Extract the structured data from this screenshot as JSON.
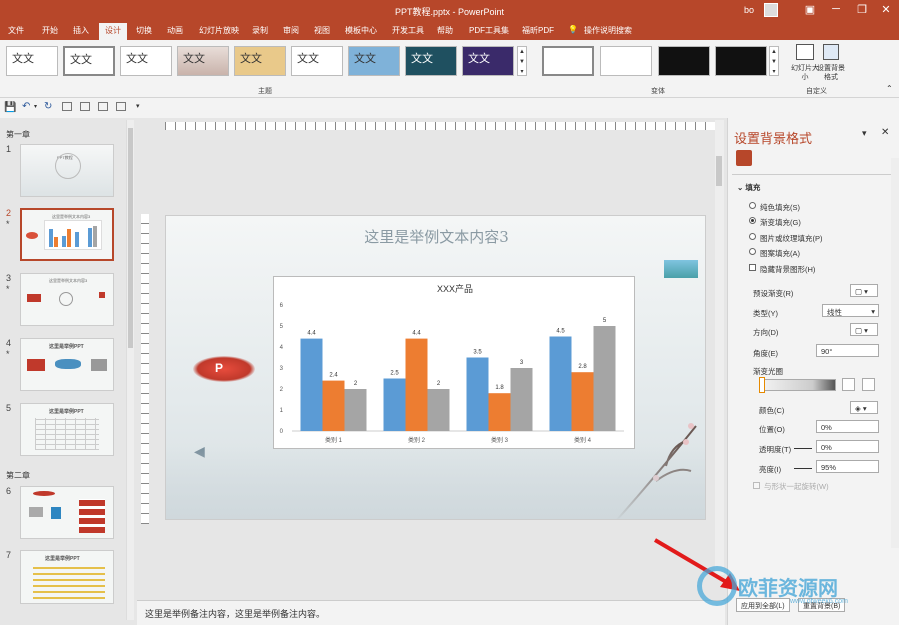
{
  "titlebar": {
    "title": "PPT教程.pptx  -  PowerPoint",
    "user": "bo",
    "min": "─",
    "restore": "❐",
    "close": "✕"
  },
  "tabs": [
    "文件",
    "开始",
    "插入",
    "设计",
    "切换",
    "动画",
    "幻灯片放映",
    "录制",
    "审阅",
    "视图",
    "模板中心",
    "开发工具",
    "帮助",
    "PDF工具集",
    "福昕PDF",
    "操作说明搜索"
  ],
  "active_tab": "设计",
  "ribbon": {
    "themes": [
      "文文",
      "文文",
      "文文",
      "文文",
      "文文",
      "文文",
      "文文",
      "文文",
      "文文"
    ],
    "theme_group": "主题",
    "variant_group": "变体",
    "custom_group": "自定义",
    "slide_size": "幻灯片大小",
    "format_bg": "设置背景格式"
  },
  "slides": {
    "section1": "第一章",
    "section2": "第二章",
    "numbers": [
      "1",
      "2",
      "3",
      "4",
      "5",
      "6",
      "7"
    ],
    "thumb_titles": [
      "PPT教程",
      "这里是举例文本内容3",
      "这里是举例文本内容3",
      "这里是举例PPT",
      "这里是举例PPT",
      "",
      "这里是举例PPT"
    ]
  },
  "slide": {
    "title": "这里是举例文本内容3"
  },
  "chart_data": {
    "type": "bar",
    "title": "XXX产品",
    "categories": [
      "类别 1",
      "类别 2",
      "类别 3",
      "类别 4"
    ],
    "series": [
      {
        "values": [
          4.4,
          2.5,
          3.5,
          4.5
        ],
        "color": "#5b9bd5"
      },
      {
        "values": [
          2.4,
          4.4,
          1.8,
          2.8
        ],
        "color": "#ed7d31"
      },
      {
        "values": [
          2,
          2,
          3,
          5
        ],
        "color": "#a5a5a5"
      }
    ],
    "ylim": [
      0,
      6
    ],
    "yticks": [
      "0",
      "1",
      "2",
      "3",
      "4",
      "5",
      "6"
    ],
    "data_labels": true,
    "grid": false
  },
  "notes": "这里是举例备注内容，这里是举例备注内容。",
  "pane": {
    "title": "设置背景格式",
    "fill_header": "填充",
    "options": [
      "纯色填充(S)",
      "渐变填充(G)",
      "图片或纹理填充(P)",
      "图案填充(A)"
    ],
    "hide_bg": "隐藏背景图形(H)",
    "preset": "预设渐变(R)",
    "type_label": "类型(Y)",
    "type_value": "线性",
    "direction": "方向(D)",
    "angle": "角度(E)",
    "angle_value": "90°",
    "stops": "渐变光圈",
    "color": "颜色(C)",
    "position": "位置(O)",
    "position_value": "0%",
    "transparency": "透明度(T)",
    "transparency_value": "0%",
    "brightness": "亮度(I)",
    "brightness_value": "95%",
    "rotate": "与形状一起旋转(W)",
    "apply_all": "应用到全部(L)",
    "reset": "重置背景(B)"
  },
  "watermark": {
    "name": "欧菲资源网",
    "url": "www.ofweek6.com"
  }
}
